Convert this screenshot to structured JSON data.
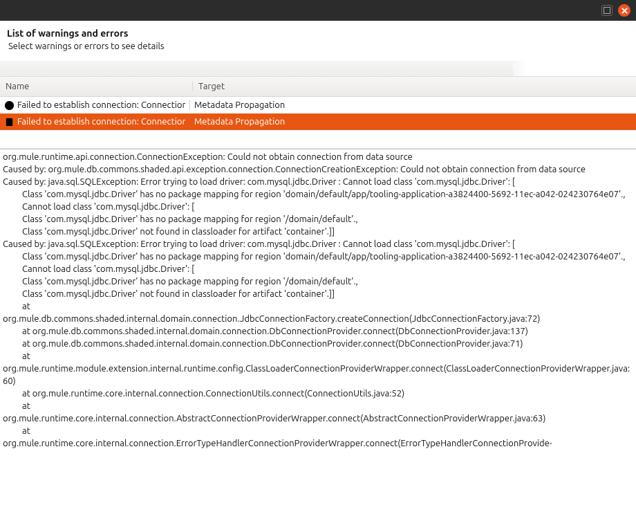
{
  "titlebar": {
    "maximize_name": "maximize-button",
    "close_name": "close-button"
  },
  "header": {
    "title": "List of warnings and errors",
    "subtitle": "Select warnings or errors to see details"
  },
  "columns": {
    "name": "Name",
    "target": "Target"
  },
  "rows": [
    {
      "icon": "error-icon",
      "name": "Failed to establish connection: Connection",
      "target": "Metadata Propagation",
      "selected": false
    },
    {
      "icon": "warning-icon",
      "name": "Failed to establish connection: Connection",
      "target": "Metadata Propagation",
      "selected": true
    }
  ],
  "details": [
    {
      "cls": "",
      "text": "org.mule.runtime.api.connection.ConnectionException: Could not obtain connection from data source"
    },
    {
      "cls": "",
      "text": "Caused by: org.mule.db.commons.shaded.api.exception.connection.ConnectionCreationException: Could not obtain connection from data source"
    },
    {
      "cls": "",
      "text": "Caused by: java.sql.SQLException: Error trying to load driver: com.mysql.jdbc.Driver : Cannot load class 'com.mysql.jdbc.Driver': ["
    },
    {
      "cls": "ind1",
      "text": "Class 'com.mysql.jdbc.Driver' has no package mapping for region 'domain/default/app/tooling-application-a3824400-5692-11ec-a042-024230764e07'.,"
    },
    {
      "cls": "ind1",
      "text": "Cannot load class 'com.mysql.jdbc.Driver': ["
    },
    {
      "cls": "ind1",
      "text": "Class 'com.mysql.jdbc.Driver' has no package mapping for region '/domain/default'.,"
    },
    {
      "cls": "ind1",
      "text": "Class 'com.mysql.jdbc.Driver' not found in classloader for artifact 'container'.]]"
    },
    {
      "cls": "",
      "text": "Caused by: java.sql.SQLException: Error trying to load driver: com.mysql.jdbc.Driver : Cannot load class 'com.mysql.jdbc.Driver': ["
    },
    {
      "cls": "ind1",
      "text": "Class 'com.mysql.jdbc.Driver' has no package mapping for region 'domain/default/app/tooling-application-a3824400-5692-11ec-a042-024230764e07'.,"
    },
    {
      "cls": "ind1",
      "text": "Cannot load class 'com.mysql.jdbc.Driver': ["
    },
    {
      "cls": "ind1",
      "text": "Class 'com.mysql.jdbc.Driver' has no package mapping for region '/domain/default'.,"
    },
    {
      "cls": "ind1",
      "text": "Class 'com.mysql.jdbc.Driver' not found in classloader for artifact 'container'.]]"
    },
    {
      "cls": "ind1",
      "text": "at"
    },
    {
      "cls": "",
      "text": "org.mule.db.commons.shaded.internal.domain.connection.JdbcConnectionFactory.createConnection(JdbcConnectionFactory.java:72)"
    },
    {
      "cls": "ind1",
      "text": "at org.mule.db.commons.shaded.internal.domain.connection.DbConnectionProvider.connect(DbConnectionProvider.java:137)"
    },
    {
      "cls": "ind1",
      "text": "at org.mule.db.commons.shaded.internal.domain.connection.DbConnectionProvider.connect(DbConnectionProvider.java:71)"
    },
    {
      "cls": "ind1",
      "text": "at"
    },
    {
      "cls": "",
      "text": "org.mule.runtime.module.extension.internal.runtime.config.ClassLoaderConnectionProviderWrapper.connect(ClassLoaderConnectionProviderWrapper.java:60)"
    },
    {
      "cls": "ind1",
      "text": "at org.mule.runtime.core.internal.connection.ConnectionUtils.connect(ConnectionUtils.java:52)"
    },
    {
      "cls": "ind1",
      "text": "at"
    },
    {
      "cls": "",
      "text": "org.mule.runtime.core.internal.connection.AbstractConnectionProviderWrapper.connect(AbstractConnectionProviderWrapper.java:63)"
    },
    {
      "cls": "ind1",
      "text": "at"
    },
    {
      "cls": "",
      "text": "org.mule.runtime.core.internal.connection.ErrorTypeHandlerConnectionProviderWrapper.connect(ErrorTypeHandlerConnectionProvide-"
    }
  ]
}
